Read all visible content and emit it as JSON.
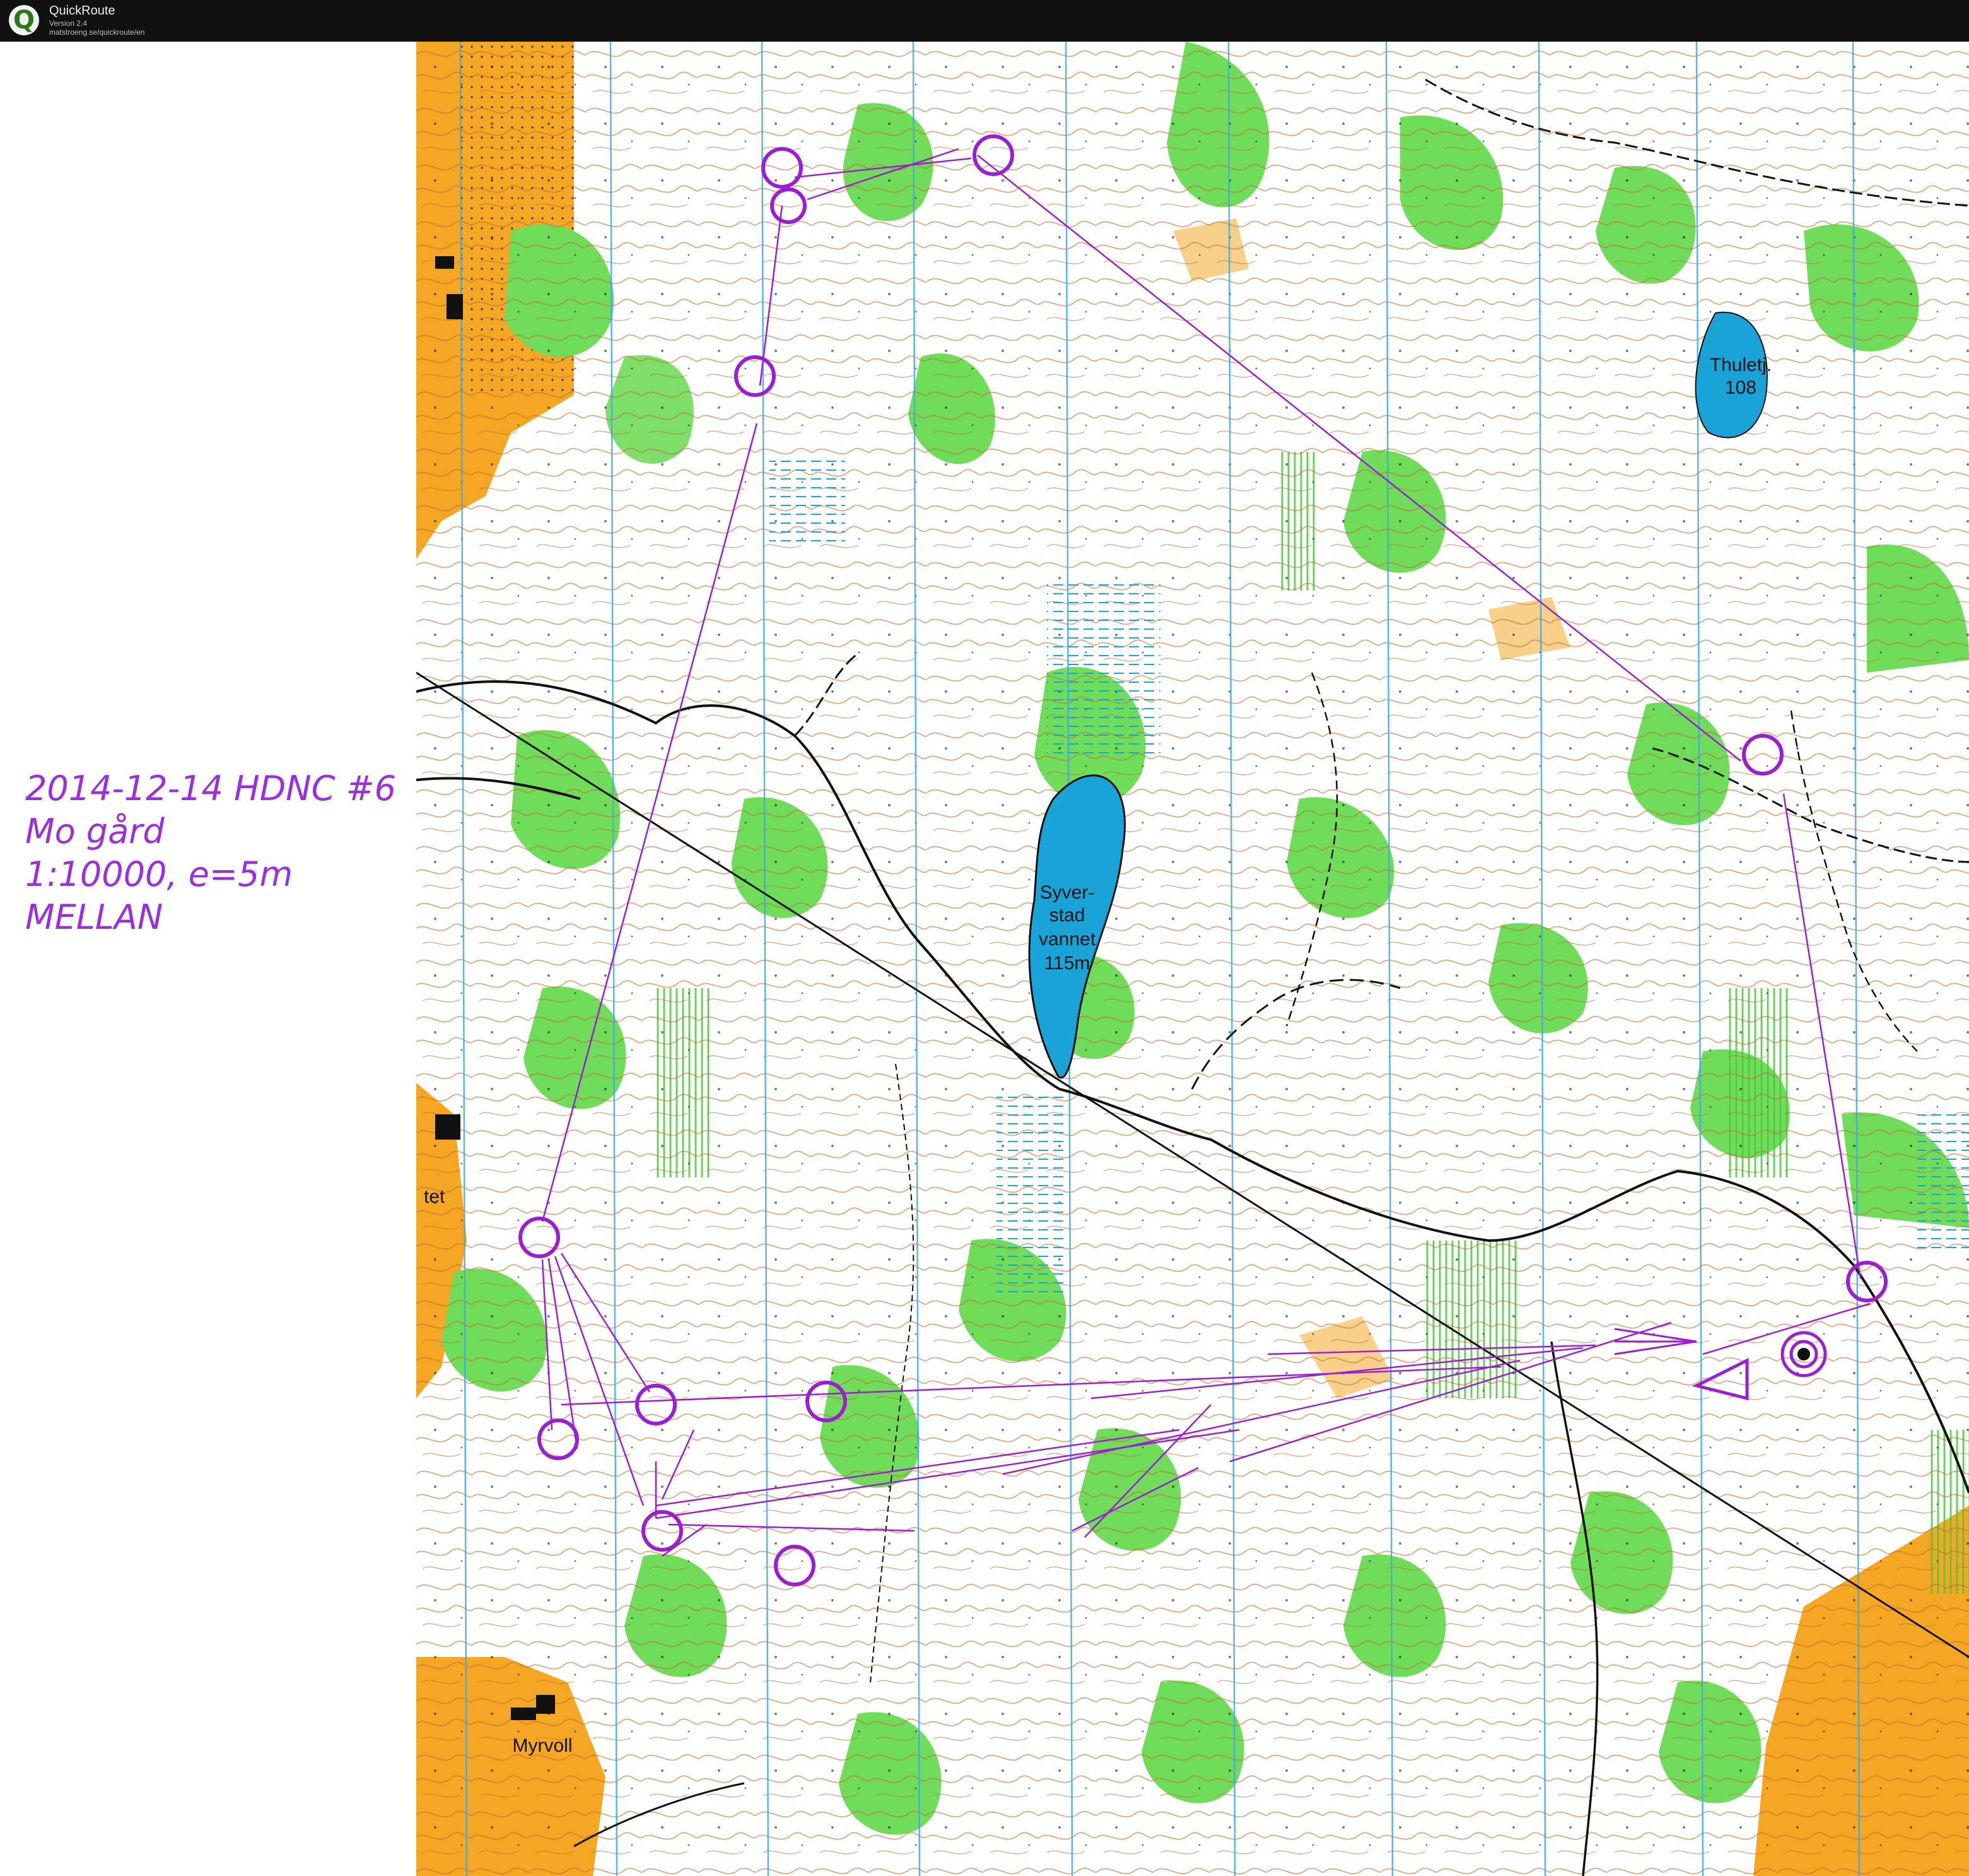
{
  "window": {
    "app_name": "QuickRoute",
    "version": "Version 2.4",
    "url": "matstroeng.se/quickroute/en",
    "icon": "quickroute-q-icon"
  },
  "map_info": {
    "line1": "2014-12-14 HDNC #6",
    "line2": "Mo gård",
    "line3": "1:10000, e=5m",
    "line4": "MELLAN"
  },
  "map": {
    "lake_syverstad": [
      "Syver-",
      "stad",
      "vannet",
      "115m"
    ],
    "lake_thuletj": [
      "Thuletj.",
      "108"
    ],
    "place_myrvoll": "Myrvoll",
    "place_tet": "tet",
    "colors": {
      "open_land": "#f5a623",
      "forest_green": "#6fdc5a",
      "water": "#1aa3d6",
      "course": "#9b1fd1",
      "contour": "#b5651d",
      "north_line": "#41a8e6"
    }
  }
}
